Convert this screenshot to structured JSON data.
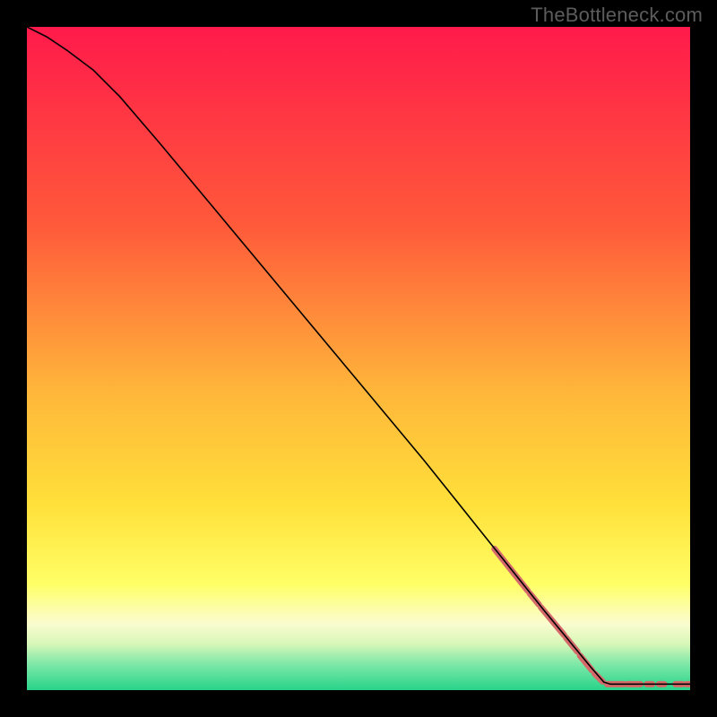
{
  "watermark": "TheBottleneck.com",
  "chart_data": {
    "type": "line",
    "title": "",
    "xlabel": "",
    "ylabel": "",
    "xlim": [
      0,
      100
    ],
    "ylim": [
      0,
      100
    ],
    "grid": false,
    "legend": false,
    "background_gradient": {
      "stops": [
        {
          "offset": 0.0,
          "color": "#ff1a4b"
        },
        {
          "offset": 0.3,
          "color": "#ff5a3a"
        },
        {
          "offset": 0.55,
          "color": "#ffb63a"
        },
        {
          "offset": 0.72,
          "color": "#ffe03a"
        },
        {
          "offset": 0.84,
          "color": "#ffff66"
        },
        {
          "offset": 0.9,
          "color": "#fafcd0"
        },
        {
          "offset": 0.93,
          "color": "#d8f7b8"
        },
        {
          "offset": 0.96,
          "color": "#80e9a8"
        },
        {
          "offset": 1.0,
          "color": "#27d38a"
        }
      ]
    },
    "series": [
      {
        "name": "curve",
        "stroke": "#000000",
        "points": [
          {
            "x": 0,
            "y": 100
          },
          {
            "x": 3,
            "y": 98.5
          },
          {
            "x": 6,
            "y": 96.5
          },
          {
            "x": 10,
            "y": 93.5
          },
          {
            "x": 14,
            "y": 89.5
          },
          {
            "x": 20,
            "y": 82.5
          },
          {
            "x": 30,
            "y": 70.5
          },
          {
            "x": 40,
            "y": 58.5
          },
          {
            "x": 50,
            "y": 46.5
          },
          {
            "x": 60,
            "y": 34.5
          },
          {
            "x": 70,
            "y": 22.0
          },
          {
            "x": 78,
            "y": 12.0
          },
          {
            "x": 85,
            "y": 3.5
          },
          {
            "x": 87,
            "y": 1.2
          },
          {
            "x": 88,
            "y": 0.9
          },
          {
            "x": 90,
            "y": 0.9
          },
          {
            "x": 95,
            "y": 0.9
          },
          {
            "x": 100,
            "y": 0.9
          }
        ]
      }
    ],
    "highlight_segments": {
      "color": "#d46a6a",
      "width": 7,
      "segments": [
        {
          "x1": 70.5,
          "y1": 21.3,
          "x2": 75.5,
          "y2": 15.0
        },
        {
          "x1": 75.8,
          "y1": 14.6,
          "x2": 77.2,
          "y2": 12.9
        },
        {
          "x1": 77.5,
          "y1": 12.5,
          "x2": 81.0,
          "y2": 8.3
        },
        {
          "x1": 81.3,
          "y1": 7.9,
          "x2": 83.0,
          "y2": 5.8
        },
        {
          "x1": 83.4,
          "y1": 5.2,
          "x2": 85.2,
          "y2": 3.0
        },
        {
          "x1": 85.6,
          "y1": 2.5,
          "x2": 86.8,
          "y2": 1.3
        },
        {
          "x1": 87.5,
          "y1": 0.9,
          "x2": 90.0,
          "y2": 0.9
        },
        {
          "x1": 90.5,
          "y1": 0.9,
          "x2": 92.5,
          "y2": 0.9
        },
        {
          "x1": 93.5,
          "y1": 0.9,
          "x2": 94.3,
          "y2": 0.9
        },
        {
          "x1": 95.3,
          "y1": 0.9,
          "x2": 96.1,
          "y2": 0.9
        },
        {
          "x1": 97.8,
          "y1": 0.9,
          "x2": 98.8,
          "y2": 0.9
        },
        {
          "x1": 99.4,
          "y1": 0.9,
          "x2": 100.0,
          "y2": 0.9
        }
      ]
    }
  }
}
